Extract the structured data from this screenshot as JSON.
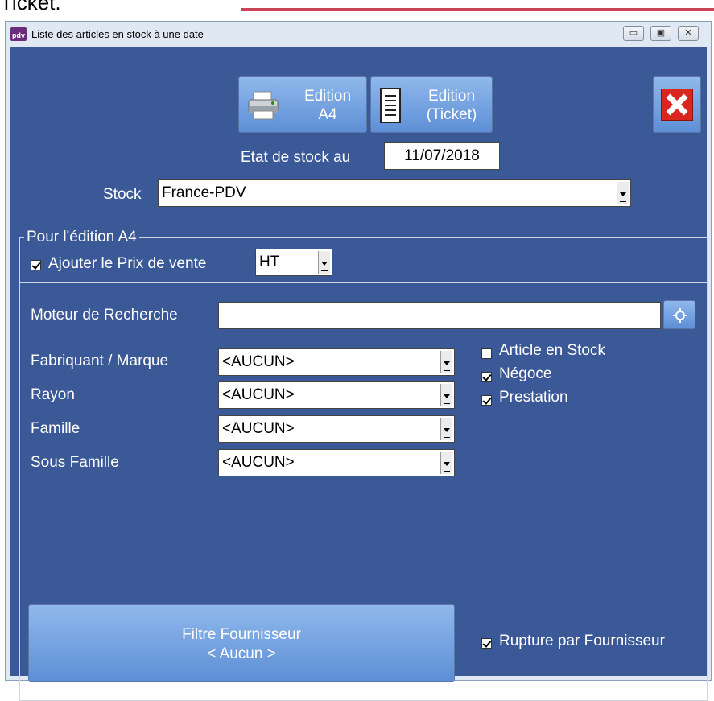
{
  "window": {
    "title": "Liste des articles en stock à une date",
    "app_icon_text": "pdv"
  },
  "toolbar": {
    "edition_a4_label": "Edition\nA4",
    "edition_ticket_label": "Edition\n(Ticket)"
  },
  "stock_date": {
    "label": "Etat de stock au",
    "value": "11/07/2018"
  },
  "stock": {
    "label": "Stock",
    "value": "France-PDV"
  },
  "a4_group": {
    "legend": "Pour l'édition A4",
    "add_price_label": "Ajouter le Prix de vente",
    "add_price_checked": true,
    "price_mode": "HT"
  },
  "search": {
    "label": "Moteur de Recherche",
    "value": ""
  },
  "filters": [
    {
      "label": "Fabriquant / Marque",
      "value": "<AUCUN>"
    },
    {
      "label": "Rayon",
      "value": "<AUCUN>"
    },
    {
      "label": "Famille",
      "value": "<AUCUN>"
    },
    {
      "label": "Sous Famille",
      "value": "<AUCUN>"
    }
  ],
  "options": [
    {
      "label": "Article en Stock",
      "checked": false
    },
    {
      "label": "Négoce",
      "checked": true
    },
    {
      "label": "Prestation",
      "checked": true
    }
  ],
  "supplier_filter": {
    "line1": "Filtre Fournisseur",
    "line2": "< Aucun >"
  },
  "rupture": {
    "label": "Rupture par Fournisseur",
    "checked": true
  },
  "colors": {
    "panel_bg": "#3c5997",
    "button_top": "#8fb8ec",
    "button_bottom": "#5e8fd6",
    "close_red": "#d9271f"
  },
  "top_cut_text": "Ticket."
}
